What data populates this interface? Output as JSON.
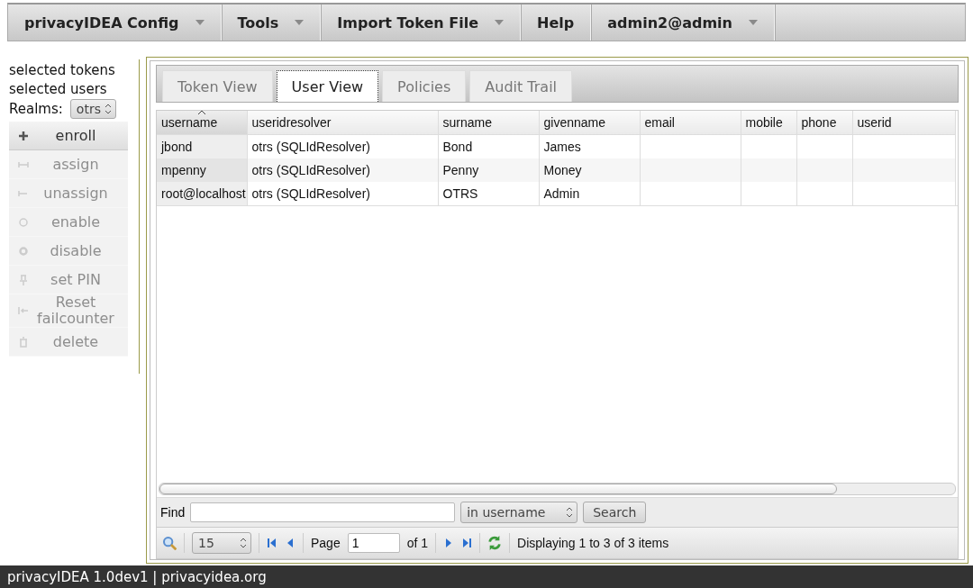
{
  "menu": [
    {
      "label": "privacyIDEA Config",
      "dropdown": true
    },
    {
      "label": "Tools",
      "dropdown": true
    },
    {
      "label": "Import Token File",
      "dropdown": true
    },
    {
      "label": "Help",
      "dropdown": false
    },
    {
      "label": "admin2@admin",
      "dropdown": true
    }
  ],
  "sidebar": {
    "labels": [
      "selected tokens",
      "selected users"
    ],
    "realm_label": "Realms:",
    "realm_value": "otrs",
    "actions": [
      {
        "label": "enroll",
        "disabled": false
      },
      {
        "label": "assign",
        "disabled": true
      },
      {
        "label": "unassign",
        "disabled": true
      },
      {
        "label": "enable",
        "disabled": true
      },
      {
        "label": "disable",
        "disabled": true
      },
      {
        "label": "set PIN",
        "disabled": true
      },
      {
        "label": "Reset failcounter",
        "disabled": true
      },
      {
        "label": "delete",
        "disabled": true
      }
    ]
  },
  "tabs": [
    {
      "label": "Token View",
      "selected": false
    },
    {
      "label": "User View",
      "selected": true
    },
    {
      "label": "Policies",
      "selected": false
    },
    {
      "label": "Audit Trail",
      "selected": false
    }
  ],
  "table": {
    "columns": [
      {
        "label": "username",
        "sorted": true
      },
      {
        "label": "useridresolver",
        "sorted": false
      },
      {
        "label": "surname",
        "sorted": false
      },
      {
        "label": "givenname",
        "sorted": false
      },
      {
        "label": "email",
        "sorted": false
      },
      {
        "label": "mobile",
        "sorted": false
      },
      {
        "label": "phone",
        "sorted": false
      },
      {
        "label": "userid",
        "sorted": false
      }
    ],
    "rows": [
      [
        "jbond",
        "otrs (SQLIdResolver)",
        "Bond",
        "James"
      ],
      [
        "mpenny",
        "otrs (SQLIdResolver)",
        "Penny",
        "Money"
      ],
      [
        "root@localhost",
        "otrs (SQLIdResolver)",
        "OTRS",
        "Admin"
      ]
    ]
  },
  "find": {
    "label": "Find",
    "scope": "in username",
    "button": "Search"
  },
  "pager": {
    "page_size": "15",
    "page_label": "Page",
    "page": "1",
    "of": "of 1",
    "status": "Displaying 1 to 3 of 3 items"
  },
  "footer": "privacyIDEA 1.0dev1 | privacyidea.org"
}
